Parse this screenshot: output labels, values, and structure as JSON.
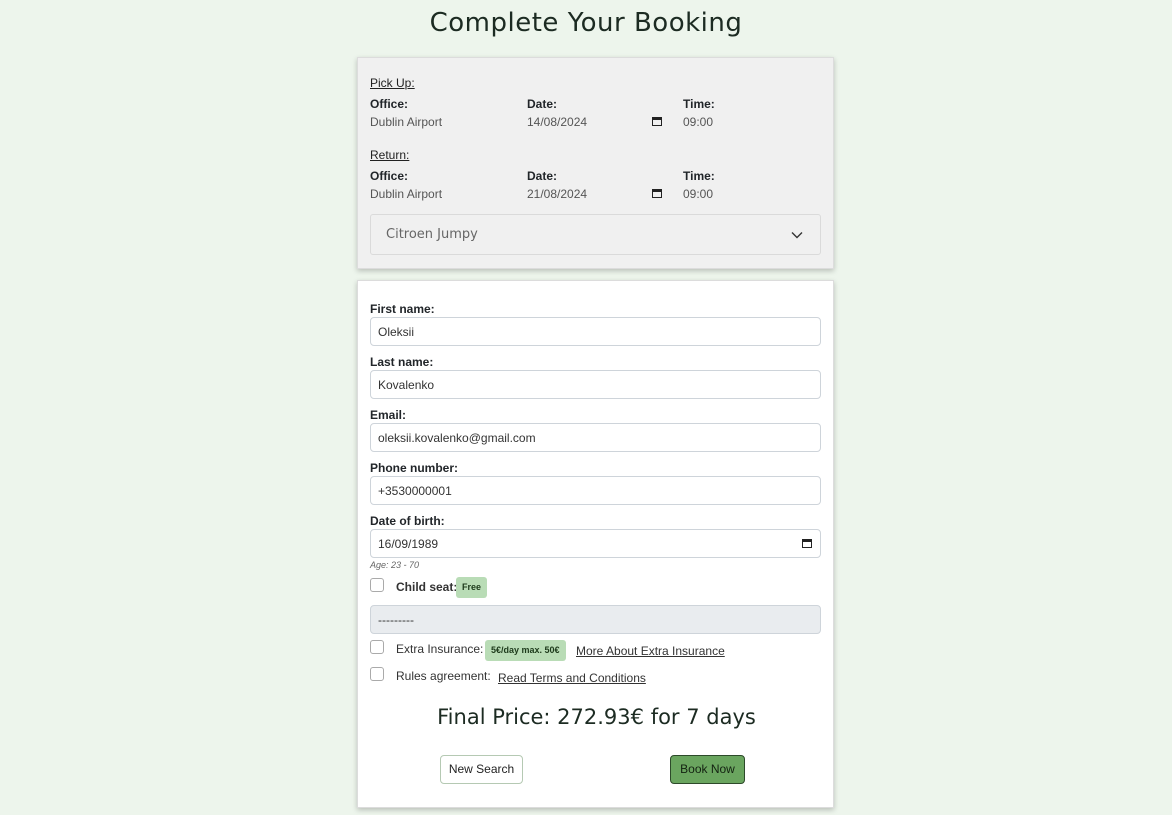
{
  "page": {
    "title": "Complete Your Booking"
  },
  "pickup": {
    "section_title": "Pick Up:",
    "office_label": "Office:",
    "office_value": "Dublin Airport",
    "date_label": "Date:",
    "date_value": "14/08/2024",
    "time_label": "Time:",
    "time_value": "09:00"
  },
  "return": {
    "section_title": "Return:",
    "office_label": "Office:",
    "office_value": "Dublin Airport",
    "date_label": "Date:",
    "date_value": "21/08/2024",
    "time_label": "Time:",
    "time_value": "09:00"
  },
  "vehicle": {
    "selected": "Citroen Jumpy",
    "icon": "chevron-down-icon"
  },
  "form": {
    "first_name_label": "First name:",
    "first_name": "Oleksii",
    "last_name_label": "Last name:",
    "last_name": "Kovalenko",
    "email_label": "Email:",
    "email": "oleksii.kovalenko@gmail.com",
    "phone_label": "Phone number:",
    "phone": "+3530000001",
    "dob_label": "Date of birth:",
    "dob": "16/09/1989",
    "age_hint": "Age: 23 - 70",
    "child_seat_label": "Child seat:",
    "child_seat_badge": "Free",
    "child_seat_select": "---------",
    "insurance_label": "Extra Insurance:",
    "insurance_badge": "5€/day max. 50€",
    "insurance_link": "More About Extra Insurance",
    "rules_label": "Rules agreement:",
    "rules_link": "Read Terms and Conditions"
  },
  "price": {
    "text": "Final Price: 272.93€ for 7 days"
  },
  "buttons": {
    "new_search": "New Search",
    "book_now": "Book Now"
  },
  "colors": {
    "background": "#edf5ec",
    "accent": "#6aa55f",
    "badge": "#b9dcb6"
  }
}
